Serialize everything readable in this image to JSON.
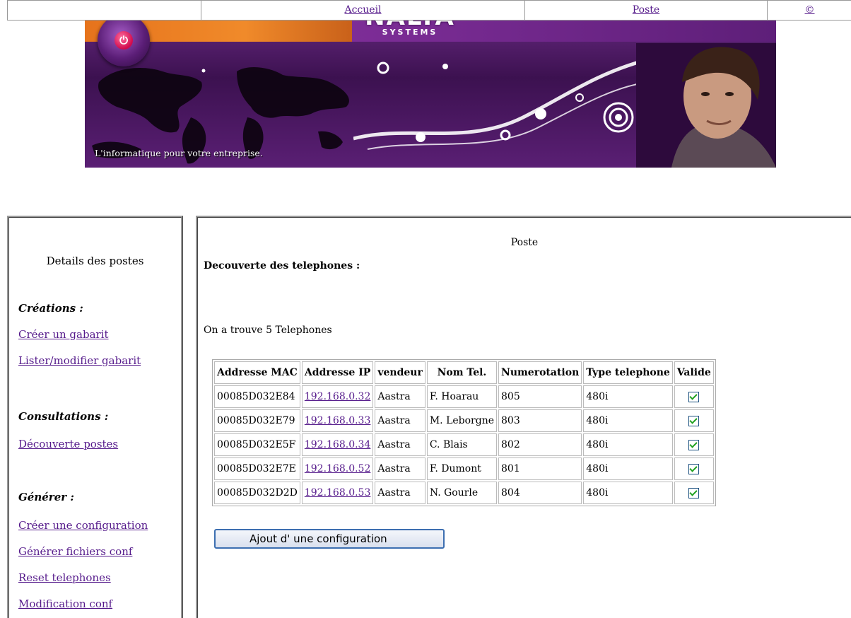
{
  "banner": {
    "logo_main": "NALTA",
    "logo_sub": "SYSTEMS",
    "tagline": "L'informatique pour votre entreprise."
  },
  "nav": {
    "items": [
      {
        "label": "Accueil"
      },
      {
        "label": "Poste"
      },
      {
        "label": "©"
      }
    ]
  },
  "sidebar": {
    "title": "Details des postes",
    "sections": [
      {
        "heading": "Créations :",
        "links": [
          "Créer un gabarit",
          "Lister/modifier gabarit"
        ]
      },
      {
        "heading": "Consultations :",
        "links": [
          "Découverte postes"
        ]
      },
      {
        "heading": "Générer :",
        "links": [
          "Créer une configuration",
          "Générer fichiers conf",
          "Reset telephones",
          "Modification conf"
        ]
      }
    ]
  },
  "main": {
    "title": "Poste",
    "heading": "Decouverte des telephones :",
    "count_text": "On a trouve 5 Telephones",
    "table": {
      "headers": [
        "Addresse MAC",
        "Addresse IP",
        "vendeur",
        "Nom Tel.",
        "Numerotation",
        "Type telephone",
        "Valide"
      ],
      "rows": [
        [
          "00085D032E84",
          "192.168.0.32",
          "Aastra",
          "F. Hoarau",
          "805",
          "480i",
          true
        ],
        [
          "00085D032E79",
          "192.168.0.33",
          "Aastra",
          "M. Leborgne",
          "803",
          "480i",
          true
        ],
        [
          "00085D032E5F",
          "192.168.0.34",
          "Aastra",
          "C. Blais",
          "802",
          "480i",
          true
        ],
        [
          "00085D032E7E",
          "192.168.0.52",
          "Aastra",
          "F. Dumont",
          "801",
          "480i",
          true
        ],
        [
          "00085D032D2D",
          "192.168.0.53",
          "Aastra",
          "N. Gourle",
          "804",
          "480i",
          true
        ]
      ]
    },
    "add_button": "Ajout d' une configuration"
  }
}
